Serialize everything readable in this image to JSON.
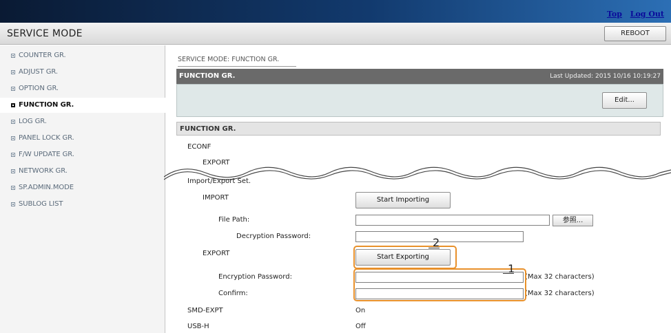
{
  "header": {
    "links": [
      "Top",
      "Log Out"
    ],
    "title": "SERVICE MODE",
    "reboot_label": "REBOOT"
  },
  "sidebar": {
    "items": [
      {
        "label": "COUNTER GR."
      },
      {
        "label": "ADJUST GR."
      },
      {
        "label": "OPTION GR."
      },
      {
        "label": "FUNCTION GR.",
        "active": true
      },
      {
        "label": "LOG GR."
      },
      {
        "label": "PANEL LOCK GR."
      },
      {
        "label": "F/W UPDATE GR."
      },
      {
        "label": "NETWORK GR."
      },
      {
        "label": "SP.ADMIN.MODE"
      },
      {
        "label": "SUBLOG LIST"
      }
    ]
  },
  "main": {
    "breadcrumb": "SERVICE MODE: FUNCTION GR.",
    "panel": {
      "title": "FUNCTION GR.",
      "last_updated": "Last Updated: 2015 10/16 10:19:27",
      "edit_label": "Edit..."
    },
    "section_title": "FUNCTION GR.",
    "econf": "ECONF",
    "export_top": "EXPORT",
    "import_export_set": "Import/Export Set.",
    "import_label": "IMPORT",
    "start_importing": "Start Importing",
    "file_path": "File Path:",
    "file_path_value": "",
    "browse_label": "参照...",
    "decryption_password": "Decryption Password:",
    "decryption_value": "",
    "export_label": "EXPORT",
    "start_exporting": "Start Exporting",
    "encryption_password": "Encryption Password:",
    "encryption_value": "",
    "encryption_hint": "(Max 32 characters)",
    "confirm": "Confirm:",
    "confirm_value": "",
    "confirm_hint": "(Max 32 characters)",
    "smd_expt": "SMD-EXPT",
    "smd_expt_value": "On",
    "usb_h": "USB-H",
    "usb_h_value": "Off"
  },
  "annotations": {
    "callout_1": "1",
    "callout_2": "2",
    "highlight_color": "#e8902a"
  }
}
